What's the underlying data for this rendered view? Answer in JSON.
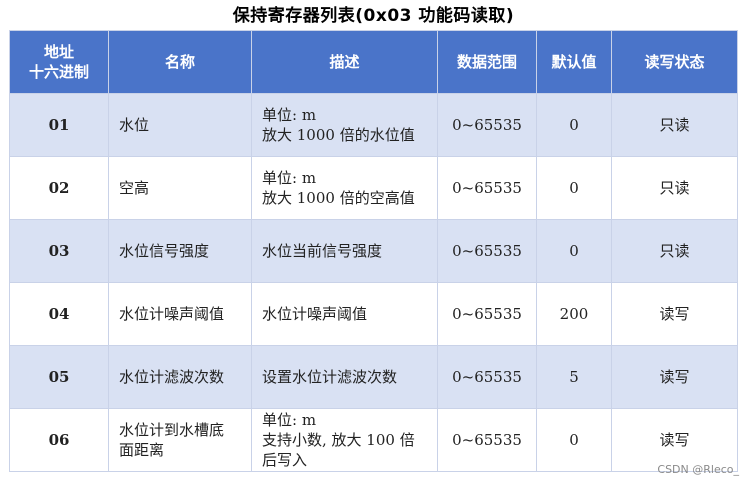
{
  "title": "保持寄存器列表(0x03 功能码读取)",
  "headers": {
    "address_line1": "地址",
    "address_line2": "十六进制",
    "name": "名称",
    "description": "描述",
    "range": "数据范围",
    "default": "默认值",
    "access": "读写状态"
  },
  "rows": [
    {
      "address": "01",
      "name_lines": [
        "水位"
      ],
      "desc_lines": [
        "单位: m",
        "放大 1000 倍的水位值"
      ],
      "range": "0~65535",
      "default": "0",
      "access": "只读"
    },
    {
      "address": "02",
      "name_lines": [
        "空高"
      ],
      "desc_lines": [
        "单位: m",
        "放大 1000 倍的空高值"
      ],
      "range": "0~65535",
      "default": "0",
      "access": "只读"
    },
    {
      "address": "03",
      "name_lines": [
        "水位信号强度"
      ],
      "desc_lines": [
        "水位当前信号强度"
      ],
      "range": "0~65535",
      "default": "0",
      "access": "只读"
    },
    {
      "address": "04",
      "name_lines": [
        "水位计噪声阈值"
      ],
      "desc_lines": [
        "水位计噪声阈值"
      ],
      "range": "0~65535",
      "default": "200",
      "access": "读写"
    },
    {
      "address": "05",
      "name_lines": [
        "水位计滤波次数"
      ],
      "desc_lines": [
        "设置水位计滤波次数"
      ],
      "range": "0~65535",
      "default": "5",
      "access": "读写"
    },
    {
      "address": "06",
      "name_lines": [
        "水位计到水槽底",
        "面距离"
      ],
      "desc_lines": [
        "单位: m",
        "支持小数, 放大 100 倍",
        "后写入"
      ],
      "range": "0~65535",
      "default": "0",
      "access": "读写"
    }
  ],
  "watermark": "CSDN @Rleco_"
}
